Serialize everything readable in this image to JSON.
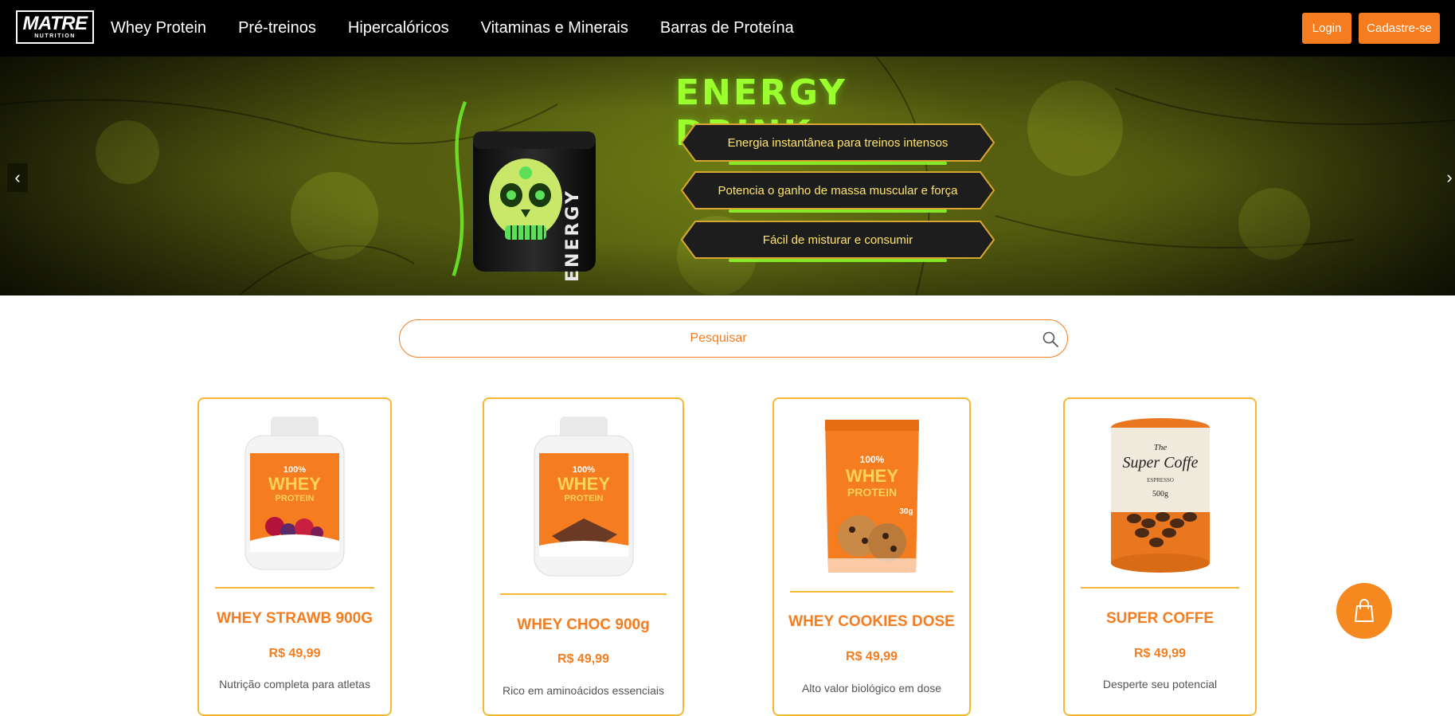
{
  "nav": {
    "logo_brand": "MATRE",
    "logo_sub": "NUTRITION",
    "items": [
      {
        "label": "Whey Protein"
      },
      {
        "label": "Pré-treinos"
      },
      {
        "label": "Hipercalóricos"
      },
      {
        "label": "Vitaminas e Minerais"
      },
      {
        "label": "Barras de Proteína"
      }
    ],
    "login_label": "Login",
    "signup_label": "Cadastre-se"
  },
  "hero": {
    "title": "ENERGY DRINK",
    "jar_label": "ENERGY",
    "features": [
      "Energia instantânea para treinos intensos",
      "Potencia o ganho de massa muscular e força",
      "Fácil de misturar e consumir"
    ],
    "prev_glyph": "‹",
    "next_glyph": "›"
  },
  "search": {
    "placeholder": "Pesquisar",
    "icon": "search-icon"
  },
  "products": [
    {
      "name": "WHEY STRAWB 900G",
      "price": "R$ 49,99",
      "desc": "Nutrição completa para atletas",
      "label_big": "WHEY",
      "label_small": "PROTEIN",
      "label_top": "100%"
    },
    {
      "name": "WHEY CHOC 900g",
      "price": "R$ 49,99",
      "desc": "Rico em aminoácidos essenciais",
      "label_big": "WHEY",
      "label_small": "PROTEIN",
      "label_top": "100%"
    },
    {
      "name": "WHEY COOKIES DOSE",
      "price": "R$ 49,99",
      "desc": "Alto valor biológico em dose",
      "label_big": "WHEY",
      "label_small": "PROTEIN",
      "label_top": "100%",
      "weight": "30g"
    },
    {
      "name": "SUPER COFFE",
      "price": "R$ 49,99",
      "desc": "Desperte seu potencial",
      "can_the": "The",
      "can_brand": "Super Coffe",
      "can_type": "ESPRESSO",
      "can_weight": "500g"
    }
  ],
  "cart": {
    "icon": "shopping-bag-icon"
  },
  "colors": {
    "accent": "#f57c1f",
    "card_border": "#f7b733",
    "hero_title": "#9bff2e",
    "feature_text": "#ffe56a",
    "nav_bg": "#000000"
  }
}
